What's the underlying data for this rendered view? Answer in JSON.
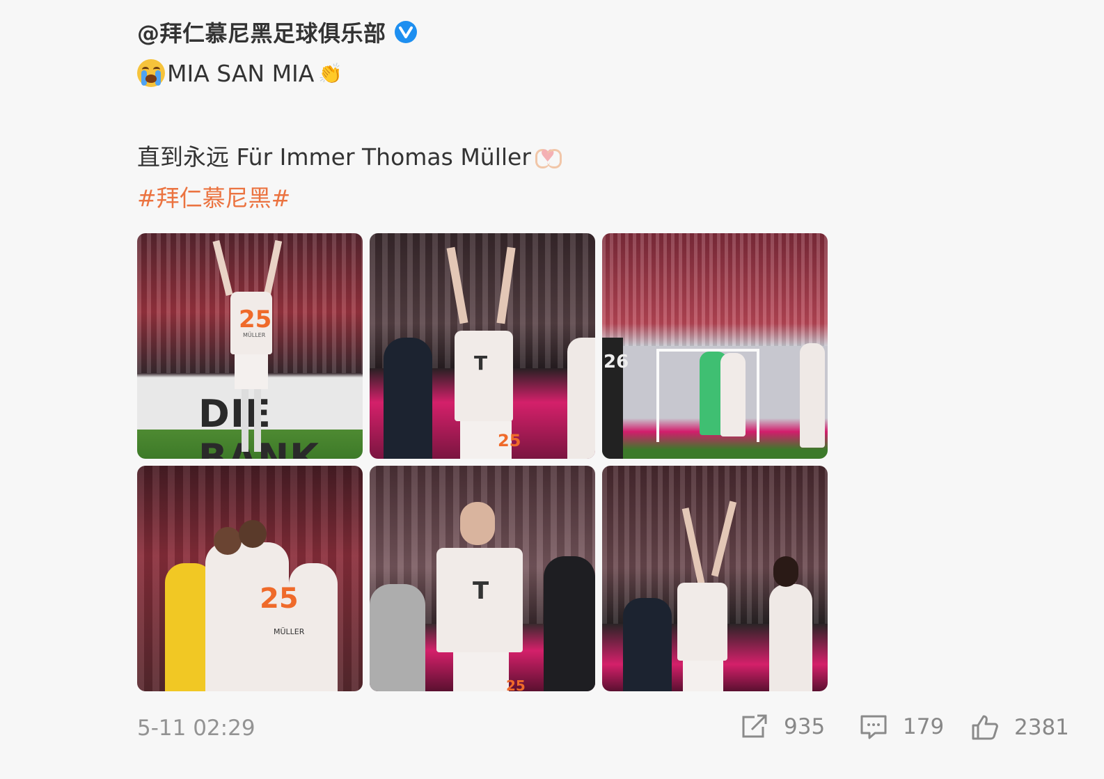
{
  "author": {
    "name": "@拜仁慕尼黑足球俱乐部",
    "verified_icon": "verified-v-icon",
    "verified_color": "#1e8ff0"
  },
  "text": {
    "line1": "MIA SAN MIA",
    "line2": "直到永远 Für Immer Thomas Müller",
    "hashtag": "#拜仁慕尼黑#",
    "hashtag_color": "#eb7340"
  },
  "photos": [
    {
      "alt_icon": "photo-player-raising-arms",
      "jersey_number": "25",
      "board_text": "DIE BANK",
      "name_text": "MÜLLER"
    },
    {
      "alt_icon": "photo-player-waving",
      "jersey_number": "25"
    },
    {
      "alt_icon": "photo-players-hugging-goalkeeper",
      "jersey_number": "26"
    },
    {
      "alt_icon": "photo-players-embracing",
      "jersey_number": "25",
      "name_text": "MÜLLER"
    },
    {
      "alt_icon": "photo-player-blowing-kiss",
      "jersey_number": "25"
    },
    {
      "alt_icon": "photo-player-waving-crowd"
    }
  ],
  "footer": {
    "time": "5-11 02:29",
    "share_count": "935",
    "comment_count": "179",
    "like_count": "2381"
  }
}
